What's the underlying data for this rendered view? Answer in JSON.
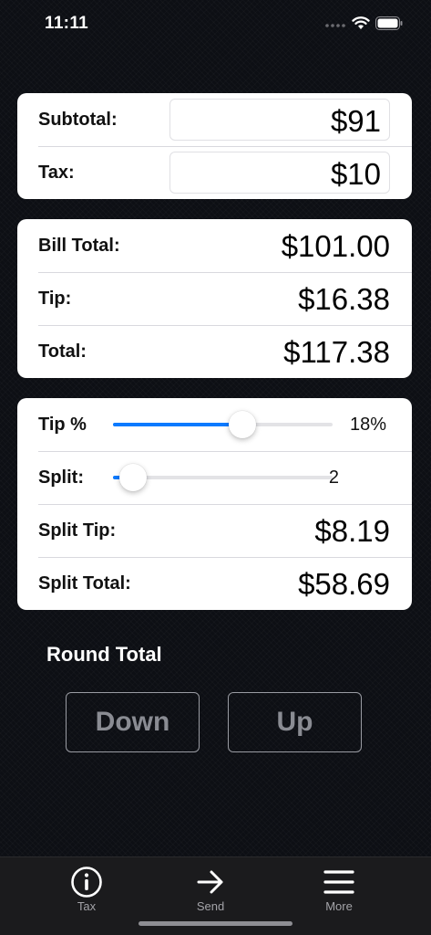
{
  "status_bar": {
    "time": "11:11",
    "icons": [
      "cellular-dots-icon",
      "wifi-icon",
      "battery-icon"
    ]
  },
  "amounts": {
    "subtotal": {
      "label": "Subtotal:",
      "value": "$91"
    },
    "tax": {
      "label": "Tax:",
      "value": "$10"
    }
  },
  "summary": {
    "bill_total": {
      "label": "Bill Total:",
      "value": "$101.00"
    },
    "tip": {
      "label": "Tip:",
      "value": "$16.38"
    },
    "total": {
      "label": "Total:",
      "value": "$117.38"
    }
  },
  "adjustments": {
    "tip_percent": {
      "label": "Tip %",
      "readout": "18%",
      "level": 0.59
    },
    "split": {
      "label": "Split:",
      "readout": "2",
      "level": 0.09
    },
    "split_tip": {
      "label": "Split Tip:",
      "value": "$8.19"
    },
    "split_total": {
      "label": "Split Total:",
      "value": "$58.69"
    }
  },
  "round_total": {
    "title": "Round Total",
    "down_label": "Down",
    "up_label": "Up"
  },
  "tab_bar": {
    "tabs": [
      {
        "label": "Tax",
        "icon": "info-icon"
      },
      {
        "label": "Send",
        "icon": "arrow-right-icon"
      },
      {
        "label": "More",
        "icon": "menu-icon"
      }
    ]
  },
  "colors": {
    "accent": "#0a7aff",
    "background": "#0d0f14",
    "card": "#ffffff",
    "tab_bar": "#1b1b1d"
  }
}
